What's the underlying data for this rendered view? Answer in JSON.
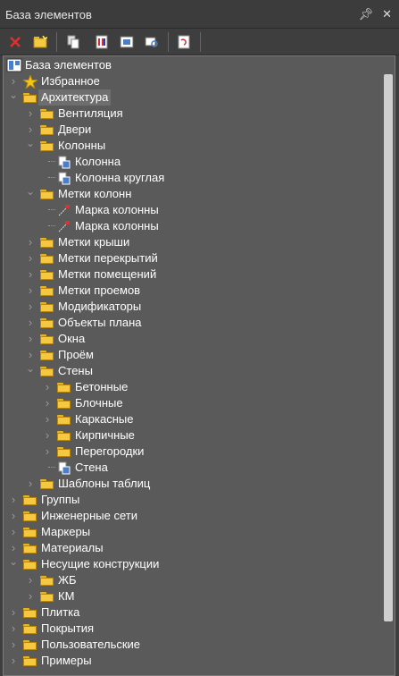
{
  "window": {
    "title": "База элементов",
    "pin_icon": "pin-icon",
    "close_icon": "close-icon"
  },
  "toolbar": [
    "delete-icon",
    "new-folder-icon",
    "copy-icon",
    "properties-icon",
    "import-icon",
    "preview-icon",
    "refresh-icon"
  ],
  "tree": {
    "root": "База элементов",
    "items": [
      {
        "label": "Избранное",
        "level": 1,
        "icon": "star-icon",
        "expanded": false
      },
      {
        "label": "Архитектура",
        "level": 1,
        "icon": "folder-icon",
        "expanded": true,
        "selected": true
      },
      {
        "label": "Вентиляция",
        "level": 2,
        "icon": "folder-icon",
        "expanded": false
      },
      {
        "label": "Двери",
        "level": 2,
        "icon": "folder-icon",
        "expanded": false
      },
      {
        "label": "Колонны",
        "level": 2,
        "icon": "folder-icon",
        "expanded": true
      },
      {
        "label": "Колонна",
        "level": 3,
        "icon": "element-icon"
      },
      {
        "label": "Колонна круглая",
        "level": 3,
        "icon": "element-icon"
      },
      {
        "label": "Метки колонн",
        "level": 2,
        "icon": "folder-icon",
        "expanded": true
      },
      {
        "label": "Марка колонны",
        "level": 3,
        "icon": "tag-icon"
      },
      {
        "label": "Марка колонны",
        "level": 3,
        "icon": "tag-icon"
      },
      {
        "label": "Метки крыши",
        "level": 2,
        "icon": "folder-icon",
        "expanded": false
      },
      {
        "label": "Метки перекрытий",
        "level": 2,
        "icon": "folder-icon",
        "expanded": false
      },
      {
        "label": "Метки помещений",
        "level": 2,
        "icon": "folder-icon",
        "expanded": false
      },
      {
        "label": "Метки проемов",
        "level": 2,
        "icon": "folder-icon",
        "expanded": false
      },
      {
        "label": "Модификаторы",
        "level": 2,
        "icon": "folder-icon",
        "expanded": false
      },
      {
        "label": "Объекты плана",
        "level": 2,
        "icon": "folder-icon",
        "expanded": false
      },
      {
        "label": "Окна",
        "level": 2,
        "icon": "folder-icon",
        "expanded": false
      },
      {
        "label": "Проём",
        "level": 2,
        "icon": "folder-icon",
        "expanded": false
      },
      {
        "label": "Стены",
        "level": 2,
        "icon": "folder-icon",
        "expanded": true
      },
      {
        "label": "Бетонные",
        "level": 3,
        "icon": "folder-icon",
        "expanded": false
      },
      {
        "label": "Блочные",
        "level": 3,
        "icon": "folder-icon",
        "expanded": false
      },
      {
        "label": "Каркасные",
        "level": 3,
        "icon": "folder-icon",
        "expanded": false
      },
      {
        "label": "Кирпичные",
        "level": 3,
        "icon": "folder-icon",
        "expanded": false
      },
      {
        "label": "Перегородки",
        "level": 3,
        "icon": "folder-icon",
        "expanded": false
      },
      {
        "label": "Стена",
        "level": 3,
        "icon": "element-icon"
      },
      {
        "label": "Шаблоны таблиц",
        "level": 2,
        "icon": "folder-icon",
        "expanded": false
      },
      {
        "label": "Группы",
        "level": 1,
        "icon": "folder-icon",
        "expanded": false
      },
      {
        "label": "Инженерные сети",
        "level": 1,
        "icon": "folder-icon",
        "expanded": false
      },
      {
        "label": "Маркеры",
        "level": 1,
        "icon": "folder-icon",
        "expanded": false
      },
      {
        "label": "Материалы",
        "level": 1,
        "icon": "folder-icon",
        "expanded": false
      },
      {
        "label": "Несущие конструкции",
        "level": 1,
        "icon": "folder-icon",
        "expanded": true
      },
      {
        "label": "ЖБ",
        "level": 2,
        "icon": "folder-icon",
        "expanded": false
      },
      {
        "label": "КМ",
        "level": 2,
        "icon": "folder-icon",
        "expanded": false
      },
      {
        "label": "Плитка",
        "level": 1,
        "icon": "folder-icon",
        "expanded": false
      },
      {
        "label": "Покрытия",
        "level": 1,
        "icon": "folder-icon",
        "expanded": false
      },
      {
        "label": "Пользовательские",
        "level": 1,
        "icon": "folder-icon",
        "expanded": false
      },
      {
        "label": "Примеры",
        "level": 1,
        "icon": "folder-icon",
        "expanded": false
      }
    ]
  }
}
